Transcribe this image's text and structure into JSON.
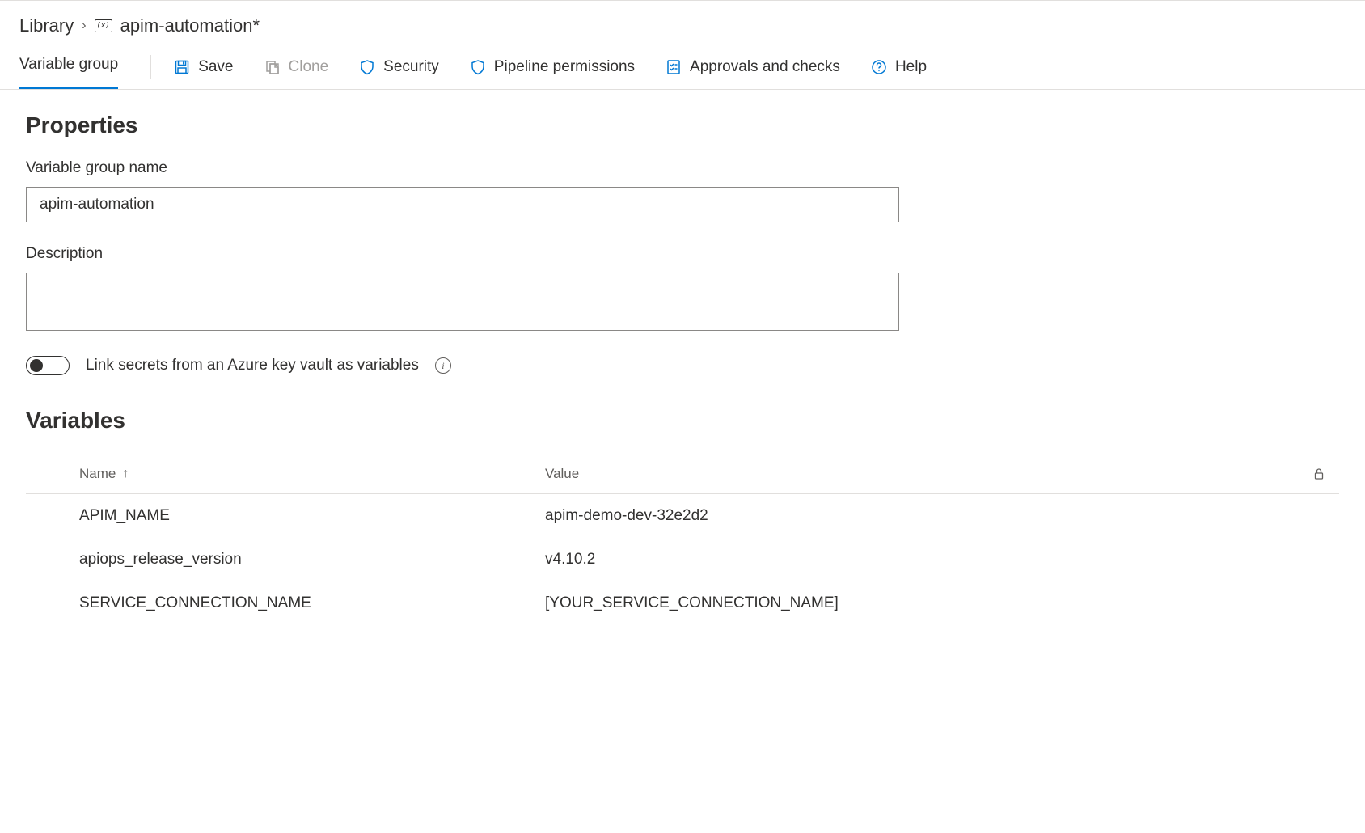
{
  "breadcrumb": {
    "root": "Library",
    "title": "apim-automation*"
  },
  "tabs": {
    "active": "Variable group"
  },
  "toolbar": {
    "save": "Save",
    "clone": "Clone",
    "security": "Security",
    "pipeline_permissions": "Pipeline permissions",
    "approvals_checks": "Approvals and checks",
    "help": "Help"
  },
  "properties": {
    "section_title": "Properties",
    "name_label": "Variable group name",
    "name_value": "apim-automation",
    "description_label": "Description",
    "description_value": "",
    "link_secrets_label": "Link secrets from an Azure key vault as variables",
    "link_secrets_value": false
  },
  "variables": {
    "section_title": "Variables",
    "columns": {
      "name": "Name",
      "value": "Value"
    },
    "rows": [
      {
        "name": "APIM_NAME",
        "value": "apim-demo-dev-32e2d2"
      },
      {
        "name": "apiops_release_version",
        "value": "v4.10.2"
      },
      {
        "name": "SERVICE_CONNECTION_NAME",
        "value": "[YOUR_SERVICE_CONNECTION_NAME]"
      }
    ]
  }
}
